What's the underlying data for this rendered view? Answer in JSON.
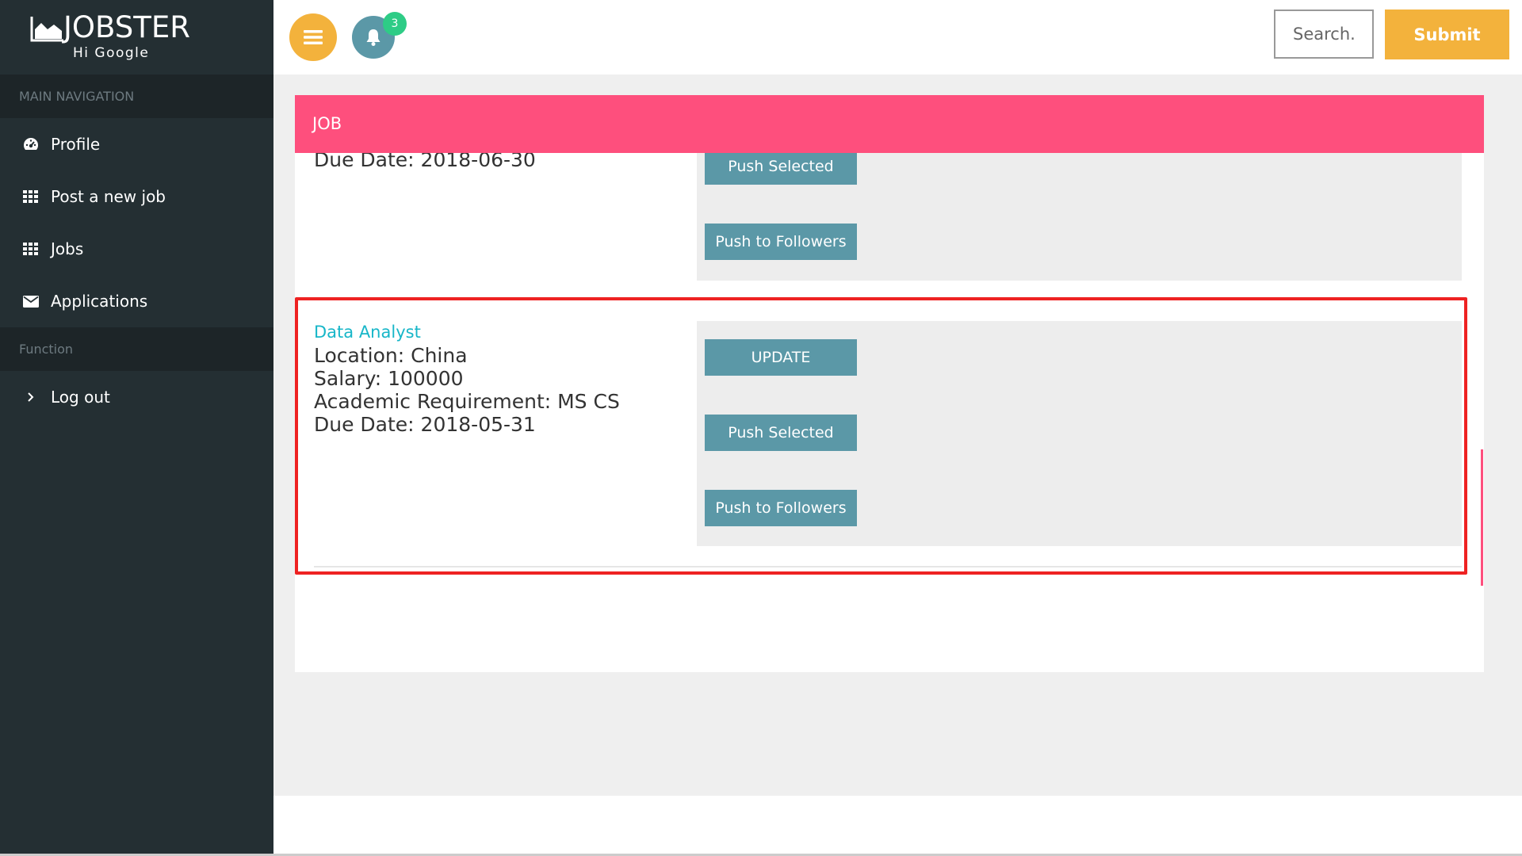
{
  "app": {
    "logo_text": "JOBSTER",
    "greeting": "Hi Google"
  },
  "sidebar": {
    "main_nav_header": "MAIN NAVIGATION",
    "items": [
      {
        "label": "Profile",
        "icon": "dashboard-icon"
      },
      {
        "label": "Post a new job",
        "icon": "grid-icon"
      },
      {
        "label": "Jobs",
        "icon": "grid-icon"
      },
      {
        "label": "Applications",
        "icon": "envelope-icon"
      }
    ],
    "function_header": "Function",
    "logout": {
      "label": "Log out",
      "icon": "chevron-right-icon"
    }
  },
  "header": {
    "menu_icon": "hamburger-icon",
    "notifications_icon": "bell-icon",
    "notification_count": "3",
    "search_placeholder": "Search.",
    "submit_label": "Submit"
  },
  "panel": {
    "title": "JOB"
  },
  "jobs": [
    {
      "due_date": "Due Date: 2018-06-30",
      "push_selected_label": "Push Selected",
      "push_followers_label": "Push to Followers"
    },
    {
      "title": "Data Analyst",
      "location": "Location: China",
      "salary": "Salary: 100000",
      "academic": "Academic Requirement: MS CS",
      "due_date": "Due Date: 2018-05-31",
      "update_label": "UPDATE",
      "push_selected_label": "Push Selected",
      "push_followers_label": "Push to Followers"
    }
  ],
  "colors": {
    "sidebar_bg": "#242f33",
    "accent_yellow": "#f3b23c",
    "panel_header_pink": "#fe4f7d",
    "button_teal": "#5b98a7",
    "link_cyan": "#17b6c8",
    "highlight_red": "#ee2222",
    "badge_green": "#2ecc86"
  }
}
